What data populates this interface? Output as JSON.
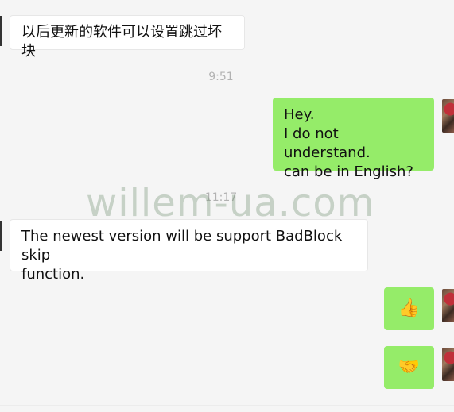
{
  "messages": [
    {
      "from": "other",
      "text": "以后更新的软件可以设置跳过坏块"
    },
    {
      "from": "system",
      "timestamp": "9:51"
    },
    {
      "from": "me",
      "lines": [
        "Hey.",
        "I do not understand.",
        "can be in English?"
      ]
    },
    {
      "from": "system",
      "timestamp": "11:17"
    },
    {
      "from": "other",
      "lines": [
        "The newest version will be support BadBlock skip",
        "function."
      ]
    },
    {
      "from": "me",
      "emoji": "👍",
      "icon": "thumbs-up"
    },
    {
      "from": "me",
      "emoji": "🤝",
      "icon": "handshake"
    }
  ],
  "watermark": "willem-ua.com",
  "colors": {
    "background": "#f5f5f5",
    "incoming_bubble": "#ffffff",
    "outgoing_bubble": "#95ec69",
    "timestamp": "#b2b2b2"
  }
}
